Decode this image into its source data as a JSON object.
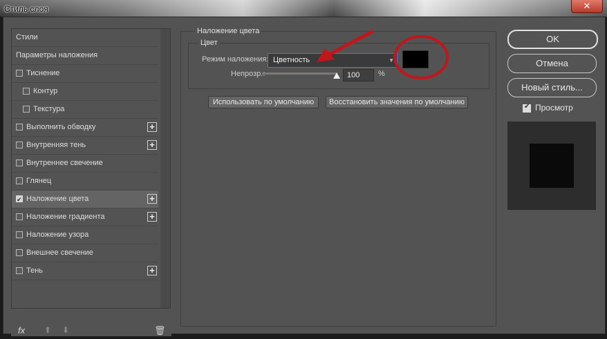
{
  "window": {
    "title": "Стиль слоя",
    "close_glyph": "✕"
  },
  "styles_list": {
    "items": [
      {
        "label": "Стили",
        "has_checkbox": false,
        "checked": false,
        "has_plus": false,
        "indent": 0
      },
      {
        "label": "Параметры наложения",
        "has_checkbox": false,
        "checked": false,
        "has_plus": false,
        "indent": 0
      },
      {
        "label": "Тиснение",
        "has_checkbox": true,
        "checked": false,
        "has_plus": false,
        "indent": 0
      },
      {
        "label": "Контур",
        "has_checkbox": true,
        "checked": false,
        "has_plus": false,
        "indent": 1
      },
      {
        "label": "Текстура",
        "has_checkbox": true,
        "checked": false,
        "has_plus": false,
        "indent": 1
      },
      {
        "label": "Выполнить обводку",
        "has_checkbox": true,
        "checked": false,
        "has_plus": true,
        "indent": 0
      },
      {
        "label": "Внутренняя тень",
        "has_checkbox": true,
        "checked": false,
        "has_plus": true,
        "indent": 0
      },
      {
        "label": "Внутреннее свечение",
        "has_checkbox": true,
        "checked": false,
        "has_plus": false,
        "indent": 0
      },
      {
        "label": "Глянец",
        "has_checkbox": true,
        "checked": false,
        "has_plus": false,
        "indent": 0
      },
      {
        "label": "Наложение цвета",
        "has_checkbox": true,
        "checked": true,
        "has_plus": true,
        "indent": 0,
        "selected": true
      },
      {
        "label": "Наложение градиента",
        "has_checkbox": true,
        "checked": false,
        "has_plus": true,
        "indent": 0
      },
      {
        "label": "Наложение узора",
        "has_checkbox": true,
        "checked": false,
        "has_plus": false,
        "indent": 0
      },
      {
        "label": "Внешнее свечение",
        "has_checkbox": true,
        "checked": false,
        "has_plus": false,
        "indent": 0
      },
      {
        "label": "Тень",
        "has_checkbox": true,
        "checked": false,
        "has_plus": true,
        "indent": 0
      }
    ],
    "fx_label": "fx",
    "up_glyph": "⬆",
    "down_glyph": "⬇",
    "trash_glyph": "🗑"
  },
  "color_overlay": {
    "group_title": "Наложение цвета",
    "subgroup_title": "Цвет",
    "blend_mode_label": "Режим наложения:",
    "blend_mode_value": "Цветность",
    "swatch_color": "#000000",
    "opacity_label": "Непрозр.:",
    "opacity_value": "100",
    "opacity_unit": "%",
    "opacity_level": 1.0,
    "use_default_button": "Использовать по умолчанию",
    "restore_default_button": "Восстановить значения по умолчанию"
  },
  "actions": {
    "ok": "OK",
    "cancel": "Отмена",
    "new_style": "Новый стиль...",
    "preview_label": "Просмотр",
    "preview_checked": true
  },
  "colors": {
    "dialog_bg": "#535353",
    "selected_row": "#646464",
    "annotation_red": "#c0161c"
  }
}
